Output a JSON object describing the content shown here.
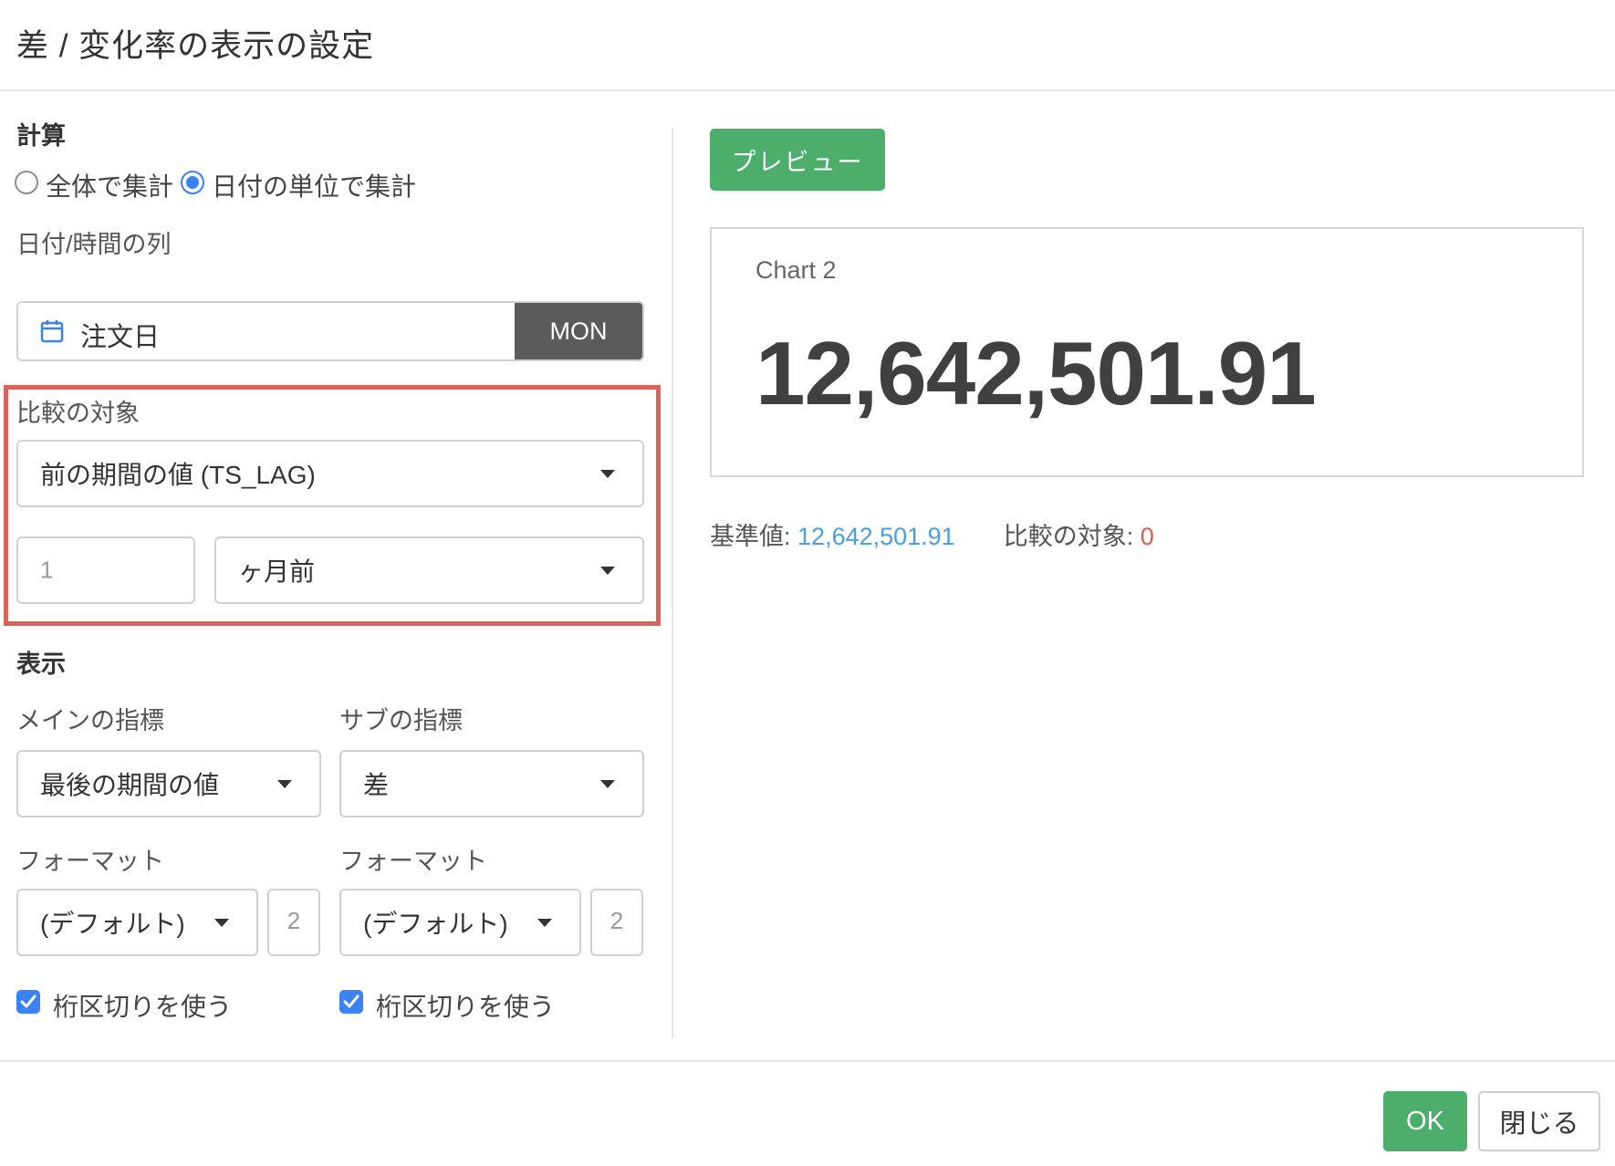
{
  "dialog": {
    "title": "差 / 変化率の表示の設定"
  },
  "calculation": {
    "section_title": "計算",
    "options": [
      {
        "label": "全体で集計",
        "checked": false
      },
      {
        "label": "日付の単位で集計",
        "checked": true
      }
    ]
  },
  "date_column": {
    "label": "日付/時間の列",
    "icon": "calendar-icon",
    "value": "注文日",
    "unit_button": "MON"
  },
  "comparison": {
    "label": "比較の対象",
    "method": "前の期間の値 (TS_LAG)",
    "offset_placeholder": "1",
    "offset_unit": "ヶ月前"
  },
  "display": {
    "section_title": "表示",
    "main_metric_label": "メインの指標",
    "main_metric_value": "最後の期間の値",
    "sub_metric_label": "サブの指標",
    "sub_metric_value": "差",
    "format_label_left": "フォーマット",
    "format_label_right": "フォーマット",
    "format_left_value": "(デフォルト)",
    "format_right_value": "(デフォルト)",
    "decimals_left": "2",
    "decimals_right": "2",
    "separator_left": "桁区切りを使う",
    "separator_right": "桁区切りを使う"
  },
  "preview": {
    "button_label": "プレビュー",
    "chart_name": "Chart 2",
    "value": "12,642,501.91",
    "baseline_label": "基準値:",
    "baseline_value": "12,642,501.91",
    "compare_label": "比較の対象:",
    "compare_value": "0"
  },
  "footer": {
    "ok_label": "OK",
    "close_label": "閉じる"
  },
  "colors": {
    "primary_green": "#4cae6a",
    "highlight_red": "#d9625b",
    "accent_blue": "#3b82f6",
    "link_blue": "#4a9fe0",
    "value_red": "#e05a4f"
  }
}
